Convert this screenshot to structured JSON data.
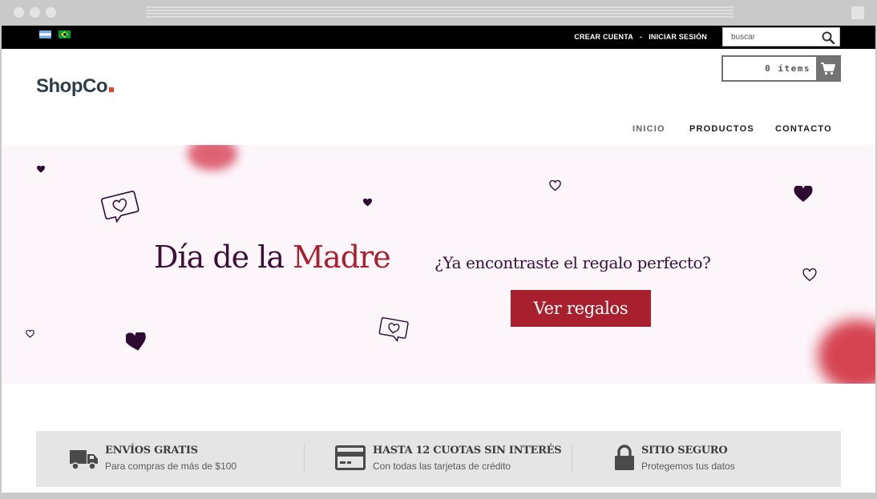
{
  "topbar": {
    "flags": [
      "argentina-flag",
      "brazil-flag"
    ],
    "create_account": "CREAR CUENTA",
    "separator": "-",
    "login": "INICIAR SESIÓN",
    "search_placeholder": "buscar"
  },
  "header": {
    "logo_text": "ShopCo",
    "cart_label": "0 ítems"
  },
  "nav": {
    "items": [
      "INICIO",
      "PRODUCTOS",
      "CONTACTO"
    ]
  },
  "hero": {
    "title_part1": "Día de la ",
    "title_part2": "Madre",
    "subtitle": "¿Ya encontraste el regalo perfecto?",
    "cta": "Ver regalos"
  },
  "benefits": [
    {
      "title": "ENVÍOS GRATIS",
      "subtitle": "Para compras de más de $100",
      "icon": "truck-icon"
    },
    {
      "title": "HASTA 12 CUOTAS SIN INTERÉS",
      "subtitle": "Con todas las tarjetas de crédito",
      "icon": "credit-card-icon"
    },
    {
      "title": "SITIO SEGURO",
      "subtitle": "Protegemos tus datos",
      "icon": "lock-icon"
    }
  ],
  "colors": {
    "accent": "#a8202e",
    "hero_text": "#3a0f3a",
    "hero_bg": "#fcf6fb",
    "logo": "#2e3d4a",
    "logo_dot": "#e3452d"
  }
}
